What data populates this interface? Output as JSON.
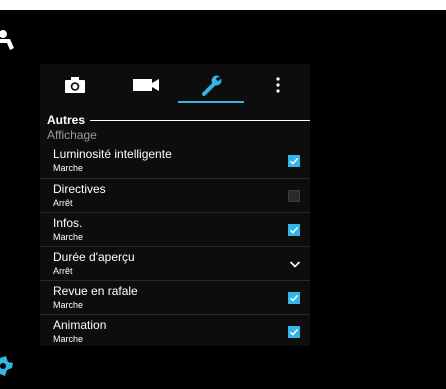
{
  "tabs": [
    {
      "icon": "camera-icon"
    },
    {
      "icon": "video-camera-icon"
    },
    {
      "icon": "wrench-icon",
      "selected": true
    },
    {
      "icon": "more-vertical-icon"
    }
  ],
  "section": {
    "title": "Autres"
  },
  "subheader": "Affichage",
  "items": [
    {
      "title": "Luminosité intelligente",
      "subtitle": "Marche",
      "control": "checkbox",
      "checked": true
    },
    {
      "title": "Directives",
      "subtitle": "Arrêt",
      "control": "checkbox",
      "checked": false
    },
    {
      "title": "Infos.",
      "subtitle": "Marche",
      "control": "checkbox",
      "checked": true
    },
    {
      "title": "Durée d'aperçu",
      "subtitle": "Arrêt",
      "control": "dropdown"
    },
    {
      "title": "Revue en rafale",
      "subtitle": "Marche",
      "control": "checkbox",
      "checked": true
    },
    {
      "title": "Animation",
      "subtitle": "Marche",
      "control": "checkbox",
      "checked": true
    }
  ],
  "colors": {
    "accent": "#33b5e5",
    "background": "#000000",
    "panel": "#0d0d0d"
  }
}
